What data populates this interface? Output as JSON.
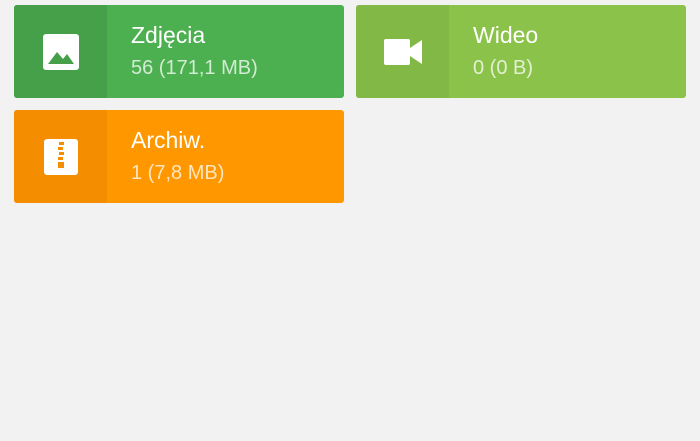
{
  "categories": [
    {
      "id": "photos",
      "title": "Zdjęcia",
      "subtitle": "56 (171,1 MB)",
      "icon": "image-icon",
      "color": "#4caf50",
      "icon_bg": "#45a049"
    },
    {
      "id": "video",
      "title": "Wideo",
      "subtitle": "0 (0 B)",
      "icon": "video-camera-icon",
      "color": "#8bc34a",
      "icon_bg": "#82b946"
    },
    {
      "id": "archive",
      "title": "Archiw.",
      "subtitle": "1 (7,8 MB)",
      "icon": "archive-zip-icon",
      "color": "#ff9800",
      "icon_bg": "#f48e00"
    }
  ]
}
